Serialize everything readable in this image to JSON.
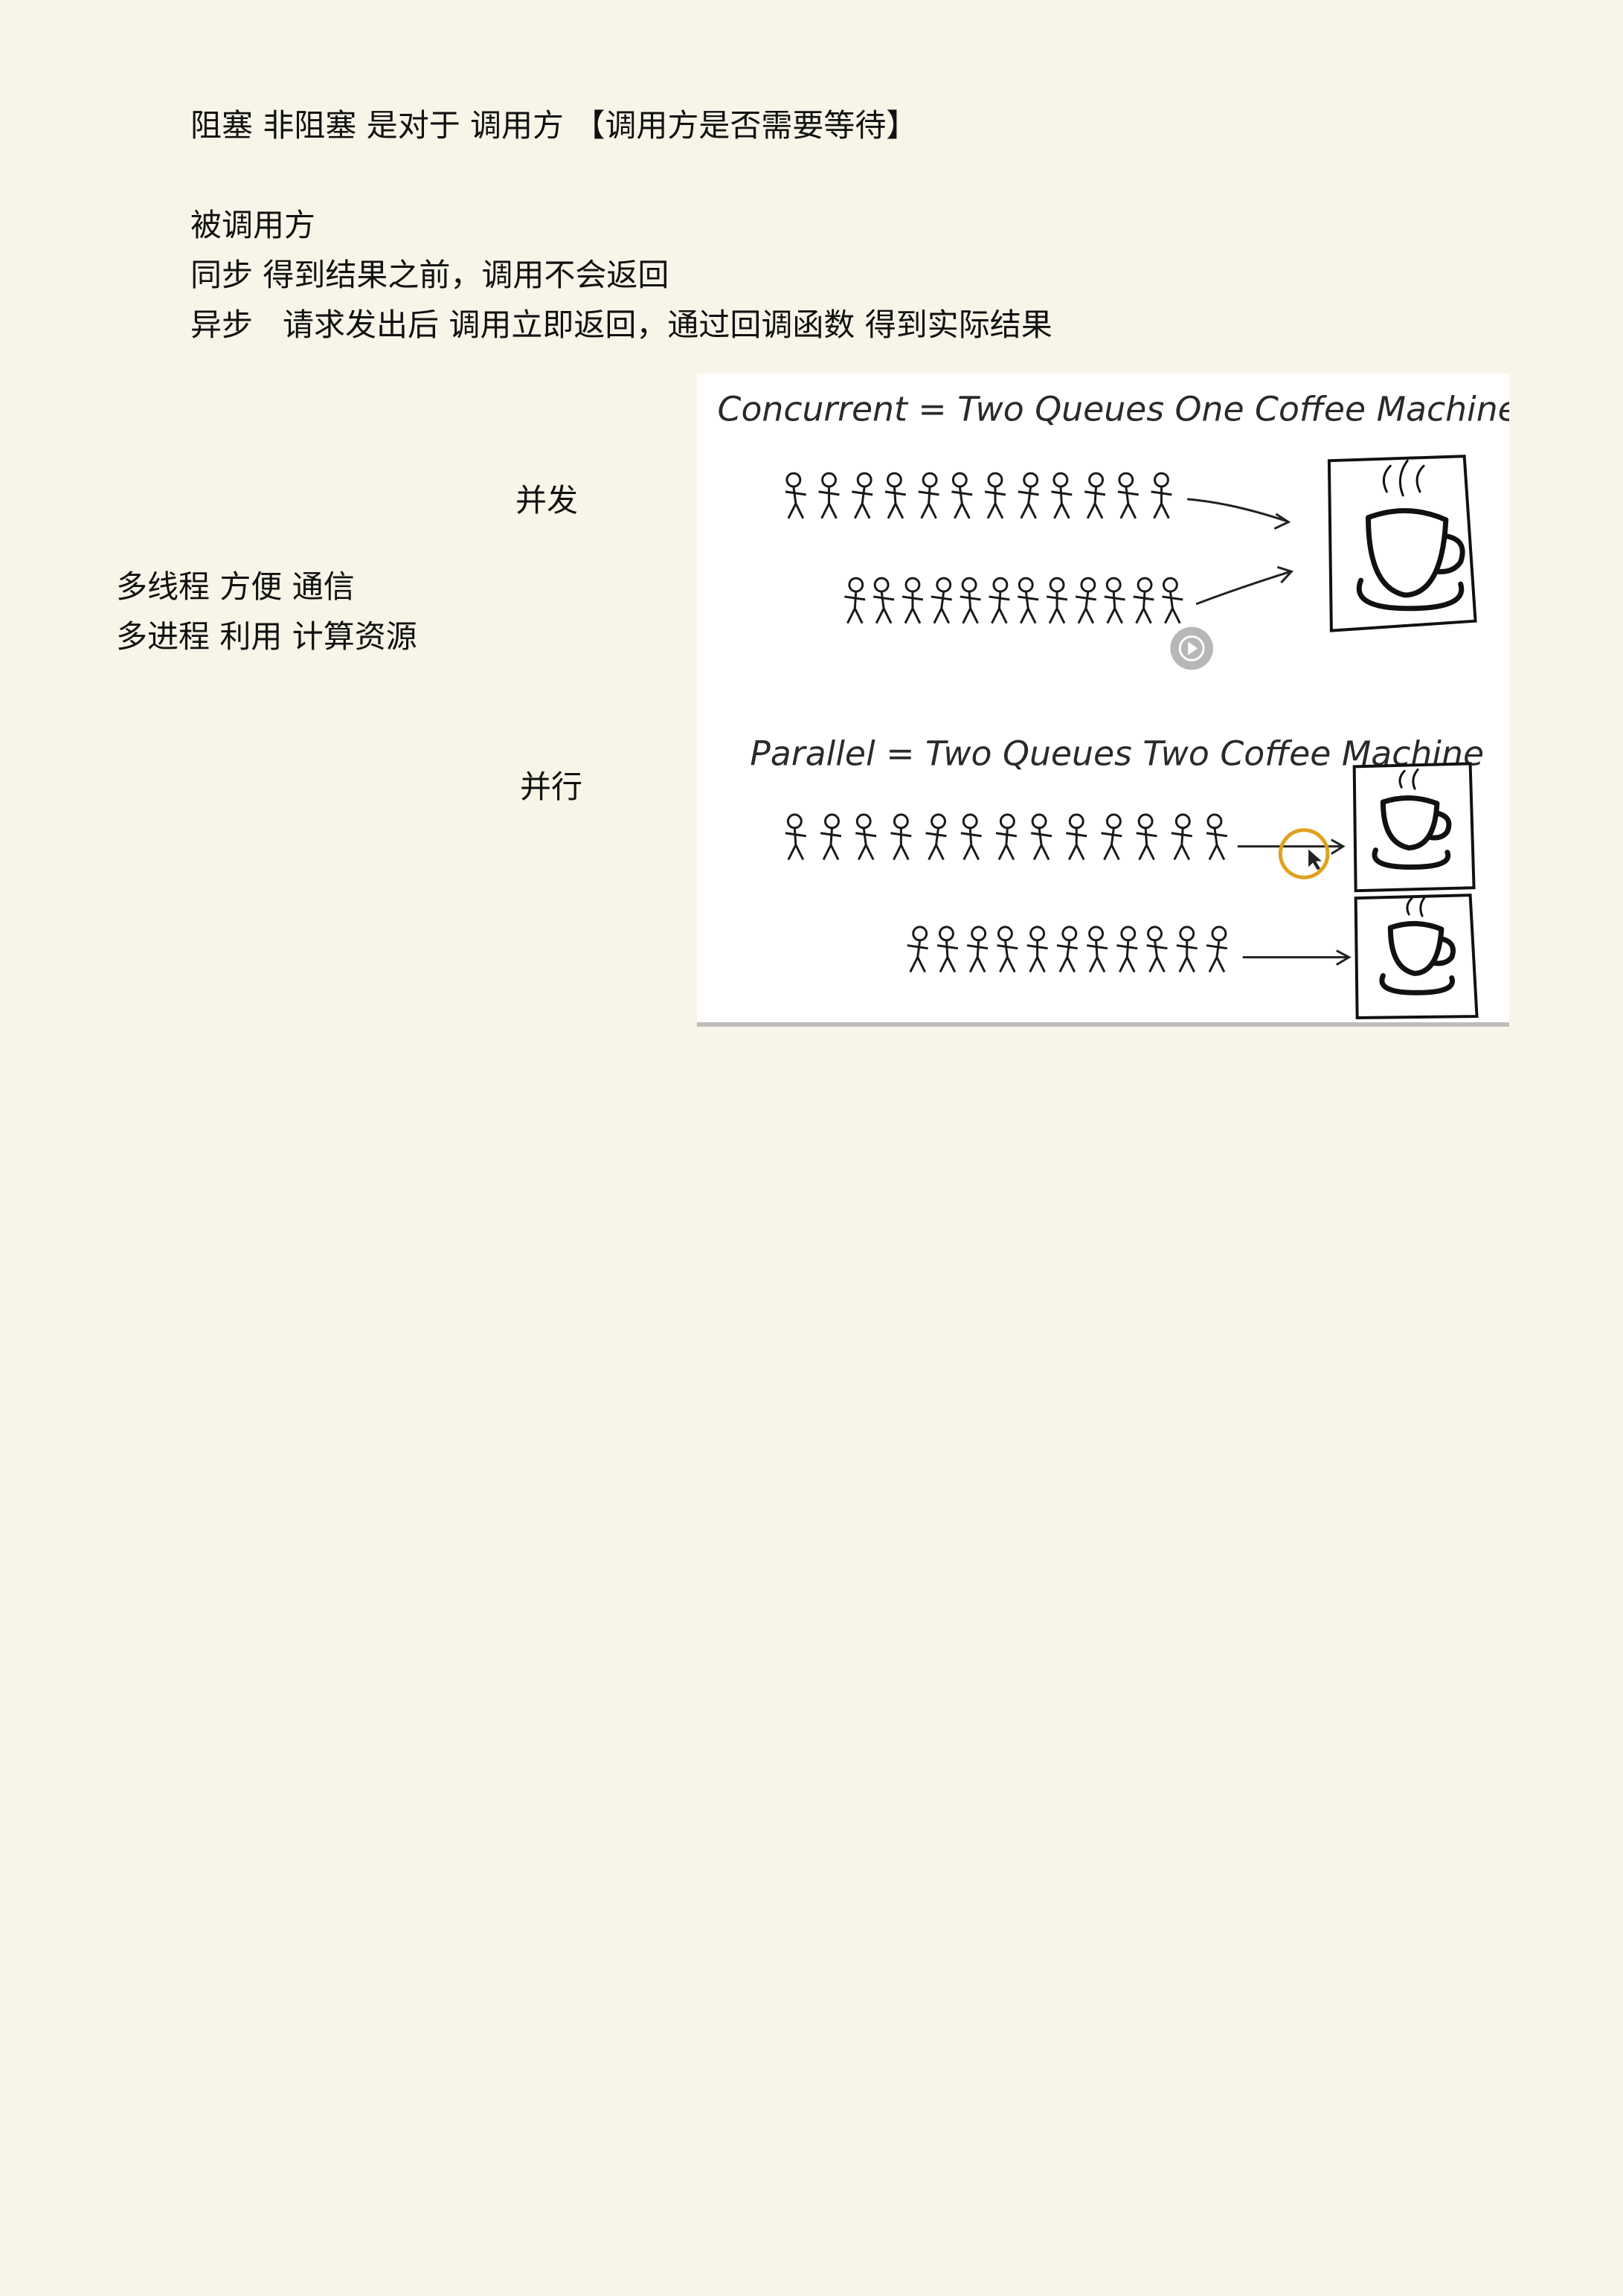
{
  "lines": {
    "blocking": "阻塞 非阻塞 是对于 调用方 【调用方是否需要等待】",
    "callee": "被调用方",
    "sync": "同步 得到结果之前，调用不会返回",
    "async": "异步   请求发出后 调用立即返回，通过回调函数 得到实际结果",
    "concurrent_label": "并发",
    "multithread": "多线程 方便 通信",
    "multiprocess": "多进程 利用 计算资源",
    "parallel_label": "并行"
  },
  "figure": {
    "concurrent_title": "Concurrent = Two Queues One Coffee Machine",
    "parallel_title": "Parallel = Two Queues Two Coffee Machine",
    "concurrent_queue_sizes": [
      12,
      12
    ],
    "parallel_queue_sizes": [
      13,
      11
    ],
    "play_icon": "play-icon",
    "cursor_highlight_color": "#e0a020"
  }
}
